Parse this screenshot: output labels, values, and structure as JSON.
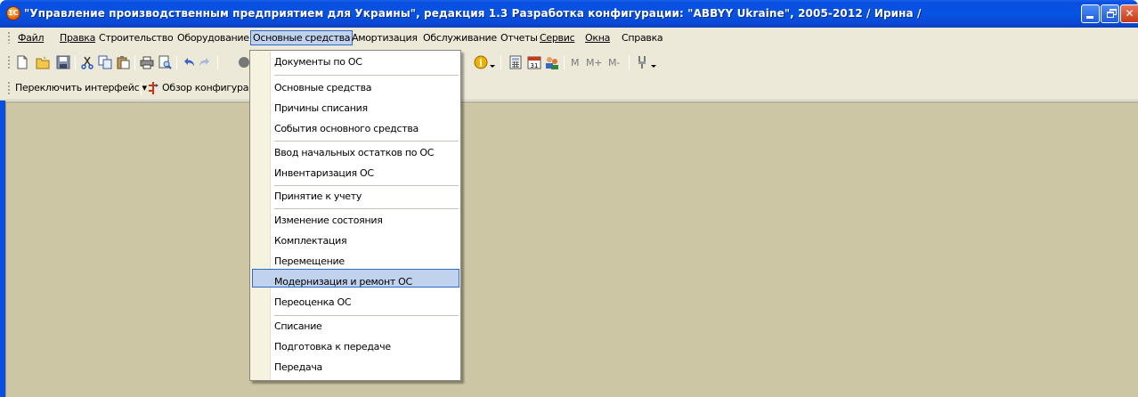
{
  "window": {
    "title": "\"Управление производственным предприятием для Украины\", редакция 1.3 Разработка конфигурации: \"ABBYY Ukraine\", 2005-2012 / Ирина /",
    "app_icon": "1c-logo-icon",
    "app_icon_text": "1С",
    "buttons": [
      "minimize",
      "restore",
      "close"
    ]
  },
  "menubar": {
    "items": [
      {
        "label": "Файл"
      },
      {
        "label": "Правка"
      },
      {
        "label": "Строительство"
      },
      {
        "label": "Оборудование"
      },
      {
        "label": "Основные средства",
        "active": true
      },
      {
        "label": "Амортизация"
      },
      {
        "label": "Обслуживание"
      },
      {
        "label": "Отчеты"
      },
      {
        "label": "Сервис"
      },
      {
        "label": "Окна"
      },
      {
        "label": "Справка"
      }
    ]
  },
  "toolbar": {
    "icons": [
      "new-document-icon",
      "open-folder-icon",
      "save-icon",
      "cut-icon",
      "copy-icon",
      "paste-icon",
      "print-icon",
      "print-preview-icon",
      "undo-icon",
      "redo-icon",
      "find-icon",
      "info-icon",
      "calculator-icon",
      "calendar-icon",
      "users-icon",
      "tools-icon"
    ],
    "memory_buttons": [
      "M",
      "M+",
      "M-"
    ]
  },
  "toolbar2": {
    "switch_interface": "Переключить интерфейс",
    "config_overview": "Обзор конфигурац"
  },
  "dropdown": {
    "highlighted": "Модернизация и ремонт ОС",
    "items": [
      {
        "label": "Документы по ОС"
      },
      {
        "label": "Основные средства"
      },
      {
        "label": "Причины списания"
      },
      {
        "label": "События основного средства"
      },
      {
        "label": "Ввод начальных остатков по ОС"
      },
      {
        "label": "Инвентаризация ОС"
      },
      {
        "label": "Принятие к учету"
      },
      {
        "label": "Изменение состояния"
      },
      {
        "label": "Комплектация"
      },
      {
        "label": "Перемещение"
      },
      {
        "label": "Модернизация и ремонт ОС"
      },
      {
        "label": "Переоценка ОС"
      },
      {
        "label": "Списание"
      },
      {
        "label": "Подготовка к передаче"
      },
      {
        "label": "Передача"
      }
    ]
  },
  "colors": {
    "titlebar": "#0554e3",
    "menu_bg": "#ece9d8",
    "workspace": "#ccc6a4",
    "highlight": "#c1d2ee",
    "highlight_border": "#316ac5"
  }
}
